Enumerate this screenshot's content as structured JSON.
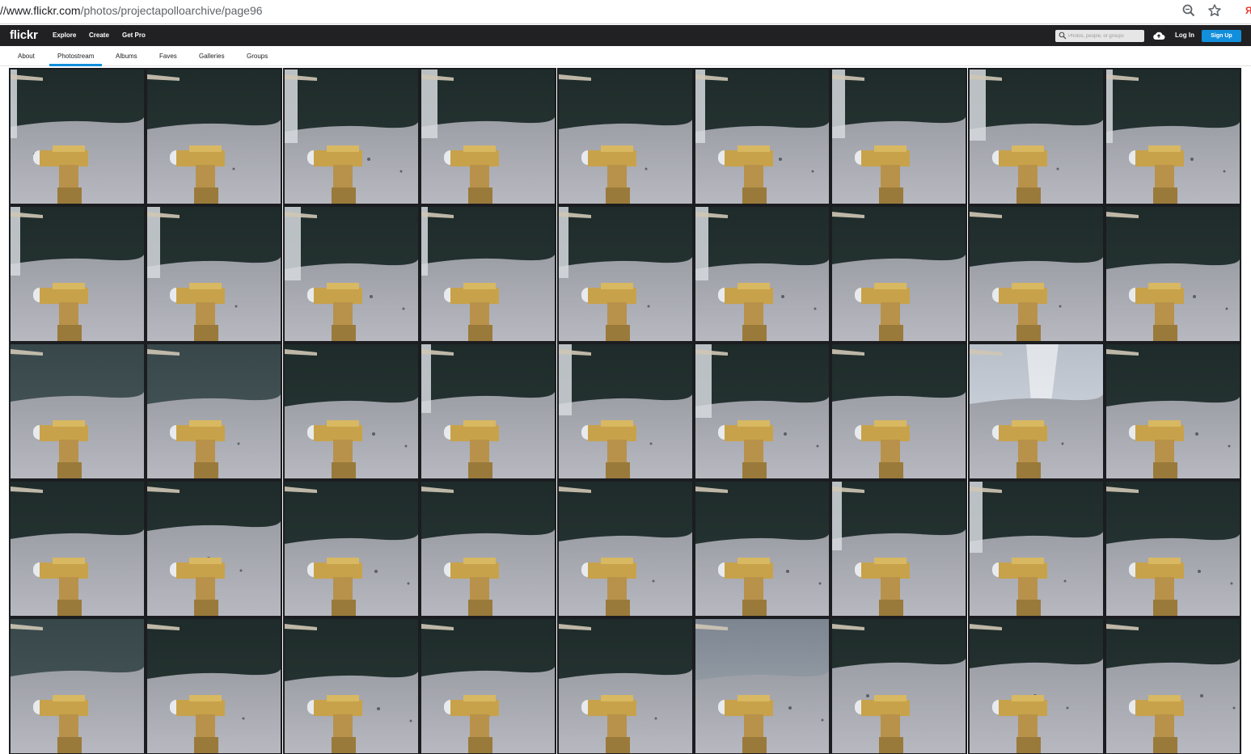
{
  "browser": {
    "url_host": "//www.flickr.com",
    "url_path": "/photos/projectapolloarchive/page96",
    "icons": [
      "zoom-icon",
      "star-icon"
    ],
    "extension_glyph": "Я"
  },
  "header": {
    "logo": "flickr",
    "nav": [
      "Explore",
      "Create",
      "Get Pro"
    ],
    "search_placeholder": "Photos, people, or groups",
    "login_label": "Log In",
    "signup_label": "Sign Up"
  },
  "subnav": {
    "tabs": [
      "About",
      "Photostream",
      "Albums",
      "Faves",
      "Galleries",
      "Groups"
    ],
    "active_tab": "Photostream"
  },
  "colors": {
    "header_bg": "#212124",
    "accent": "#128fdc",
    "sky": "#1e2b2a",
    "ground": "#a5a5ad",
    "camera_gold": "#c8a24a"
  },
  "grid": {
    "columns": 9,
    "rows": 5,
    "photos": [
      {
        "variant": "pillar-sky"
      },
      {
        "variant": "sky"
      },
      {
        "variant": "pillar-sky"
      },
      {
        "variant": "pillar-sky"
      },
      {
        "variant": "sky"
      },
      {
        "variant": "pillar-sky"
      },
      {
        "variant": "pillar-sky"
      },
      {
        "variant": "pillar-sky"
      },
      {
        "variant": "pillar-sky"
      },
      {
        "variant": "pillar-sky"
      },
      {
        "variant": "pillar-sky"
      },
      {
        "variant": "pillar-sky"
      },
      {
        "variant": "pillar-sky"
      },
      {
        "variant": "pillar-sky"
      },
      {
        "variant": "pillar-sky"
      },
      {
        "variant": "sky"
      },
      {
        "variant": "sky"
      },
      {
        "variant": "sky"
      },
      {
        "variant": "haze"
      },
      {
        "variant": "haze"
      },
      {
        "variant": "sky"
      },
      {
        "variant": "pillar-sky"
      },
      {
        "variant": "pillar-sky"
      },
      {
        "variant": "pillar-sky"
      },
      {
        "variant": "sky"
      },
      {
        "variant": "flare"
      },
      {
        "variant": "sky"
      },
      {
        "variant": "sky"
      },
      {
        "variant": "ground"
      },
      {
        "variant": "sky"
      },
      {
        "variant": "sky"
      },
      {
        "variant": "sky"
      },
      {
        "variant": "sky"
      },
      {
        "variant": "pillar-sky"
      },
      {
        "variant": "pillar-sky"
      },
      {
        "variant": "sky"
      },
      {
        "variant": "haze"
      },
      {
        "variant": "sky"
      },
      {
        "variant": "sky"
      },
      {
        "variant": "sky"
      },
      {
        "variant": "sky"
      },
      {
        "variant": "bright"
      },
      {
        "variant": "ground"
      },
      {
        "variant": "ground"
      },
      {
        "variant": "ground"
      }
    ]
  }
}
